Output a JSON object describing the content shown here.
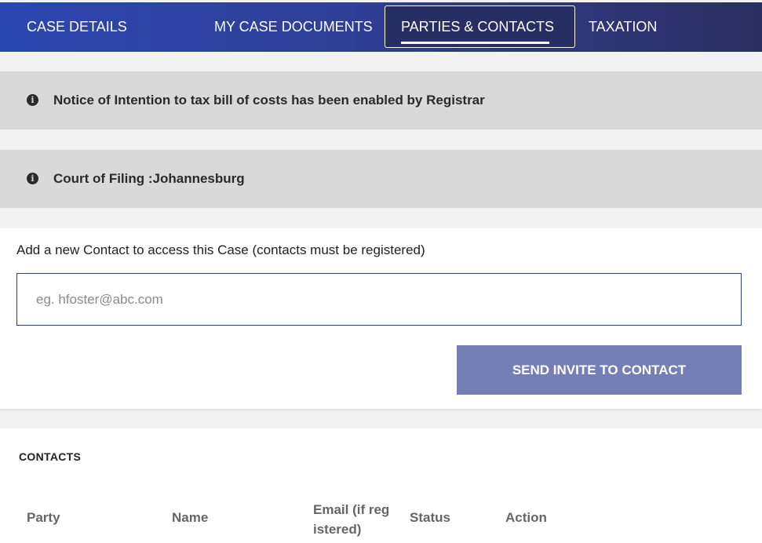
{
  "nav": {
    "tabs": [
      {
        "label": "CASE DETAILS"
      },
      {
        "label": "MY CASE DOCUMENTS"
      },
      {
        "label": "PARTIES & CONTACTS"
      },
      {
        "label": "TAXATION"
      }
    ],
    "active_tab": "PARTIES & CONTACTS"
  },
  "notices": [
    {
      "icon": "info-icon",
      "text": "Notice of Intention to tax bill of costs has been enabled by Registrar"
    },
    {
      "icon": "info-icon",
      "text": "Court of Filing :Johannesburg"
    }
  ],
  "add_contact": {
    "label": "Add a new Contact to access this Case (contacts must be registered)",
    "placeholder": "eg. hfoster@abc.com",
    "value": "",
    "button_label": "SEND INVITE TO CONTACT"
  },
  "contacts": {
    "title": "CONTACTS",
    "columns": [
      "Party",
      "Name",
      "Email (if reg istered)",
      "Status",
      "Action"
    ],
    "email_col_lines": [
      "Email (if reg",
      "istered)"
    ]
  },
  "colors": {
    "nav_gradient_start": "#2b46b0",
    "nav_gradient_end": "#2c2f62",
    "button_bg": "#7480b5",
    "notice_bg": "#d9d9d9"
  }
}
